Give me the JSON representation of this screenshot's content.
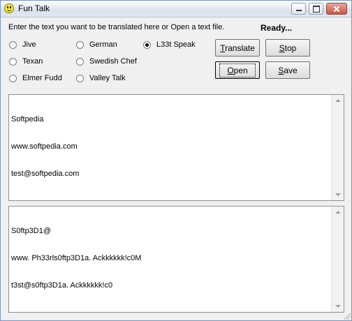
{
  "window": {
    "title": "Fun Talk"
  },
  "header": {
    "instruction": "Enter the text you want to be translated here or Open a text file.",
    "status": "Ready..."
  },
  "dialects": [
    {
      "label": "Jive",
      "checked": false
    },
    {
      "label": "German",
      "checked": false
    },
    {
      "label": "L33t Speak",
      "checked": true
    },
    {
      "label": "Texan",
      "checked": false
    },
    {
      "label": "Swedish Chef",
      "checked": false
    },
    {
      "label": "Elmer Fudd",
      "checked": false
    },
    {
      "label": "Valley Talk",
      "checked": false
    }
  ],
  "buttons": {
    "translate": {
      "first": "T",
      "rest": "ranslate"
    },
    "stop": {
      "first": "S",
      "rest": "top"
    },
    "open": {
      "first": "O",
      "rest": "pen"
    },
    "save": {
      "first": "S",
      "rest": "ave"
    }
  },
  "input_text": {
    "lines": [
      "Softpedia",
      "www.softpedia.com",
      "test@softpedia.com"
    ]
  },
  "output_text": {
    "lines": [
      "S0ftp3D1@",
      "www. Ph33rls0ftp3D1a. Ackkkkkk!c0M",
      "t3st@s0ftp3D1a. Ackkkkkk!c0"
    ]
  },
  "icons": {
    "app": "smiley-face-icon",
    "minimize": "minimize-icon",
    "maximize": "maximize-icon",
    "close": "close-icon"
  }
}
